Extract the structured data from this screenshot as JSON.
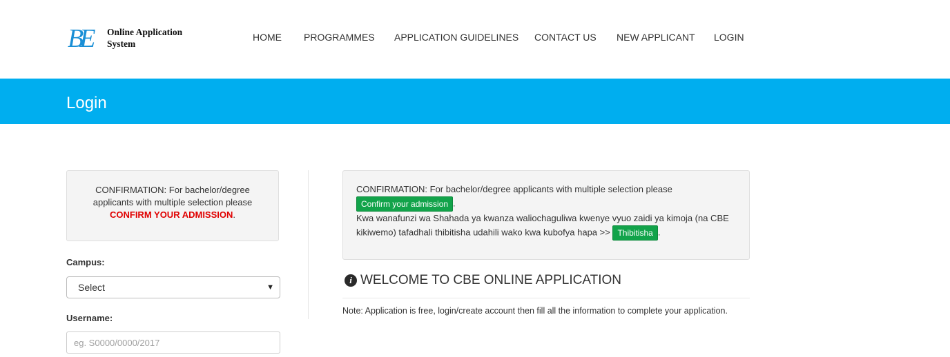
{
  "header": {
    "logo_mark": "BE",
    "logo_text_line1": "Online Application",
    "logo_text_line2": "System",
    "nav": [
      {
        "label": "HOME"
      },
      {
        "label": "PROGRAMMES"
      },
      {
        "label": "APPLICATION GUIDELINES"
      },
      {
        "label": "CONTACT US"
      },
      {
        "label": "NEW APPLICANT"
      },
      {
        "label": "LOGIN"
      }
    ]
  },
  "banner": {
    "title": "Login"
  },
  "left": {
    "confirmation_text": "CONFIRMATION: For bachelor/degree applicants with multiple selection please",
    "confirmation_link": "CONFIRM YOUR ADMISSION",
    "confirmation_period": ".",
    "campus_label": "Campus:",
    "campus_selected": "Select",
    "username_label": "Username:",
    "username_placeholder": "eg. S0000/0000/2017"
  },
  "right": {
    "confirmation_text": "CONFIRMATION: For bachelor/degree applicants with multiple selection please",
    "confirm_button": "Confirm your admission",
    "period": ".",
    "swahili_text": "Kwa wanafunzi wa Shahada ya kwanza waliochaguliwa kwenye vyuo zaidi ya kimoja (na CBE kikiwemo) tafadhali thibitisha udahili wako kwa kubofya hapa >>",
    "thibitisha_button": "Thibitisha",
    "welcome_title": "WELCOME TO CBE ONLINE APPLICATION",
    "note": "Note: Application is free, login/create account then fill all the information to complete your application."
  },
  "colors": {
    "banner": "#00aeef",
    "logo": "#1a8fd6",
    "confirm_red": "#e00000",
    "button_green": "#12a34a"
  }
}
